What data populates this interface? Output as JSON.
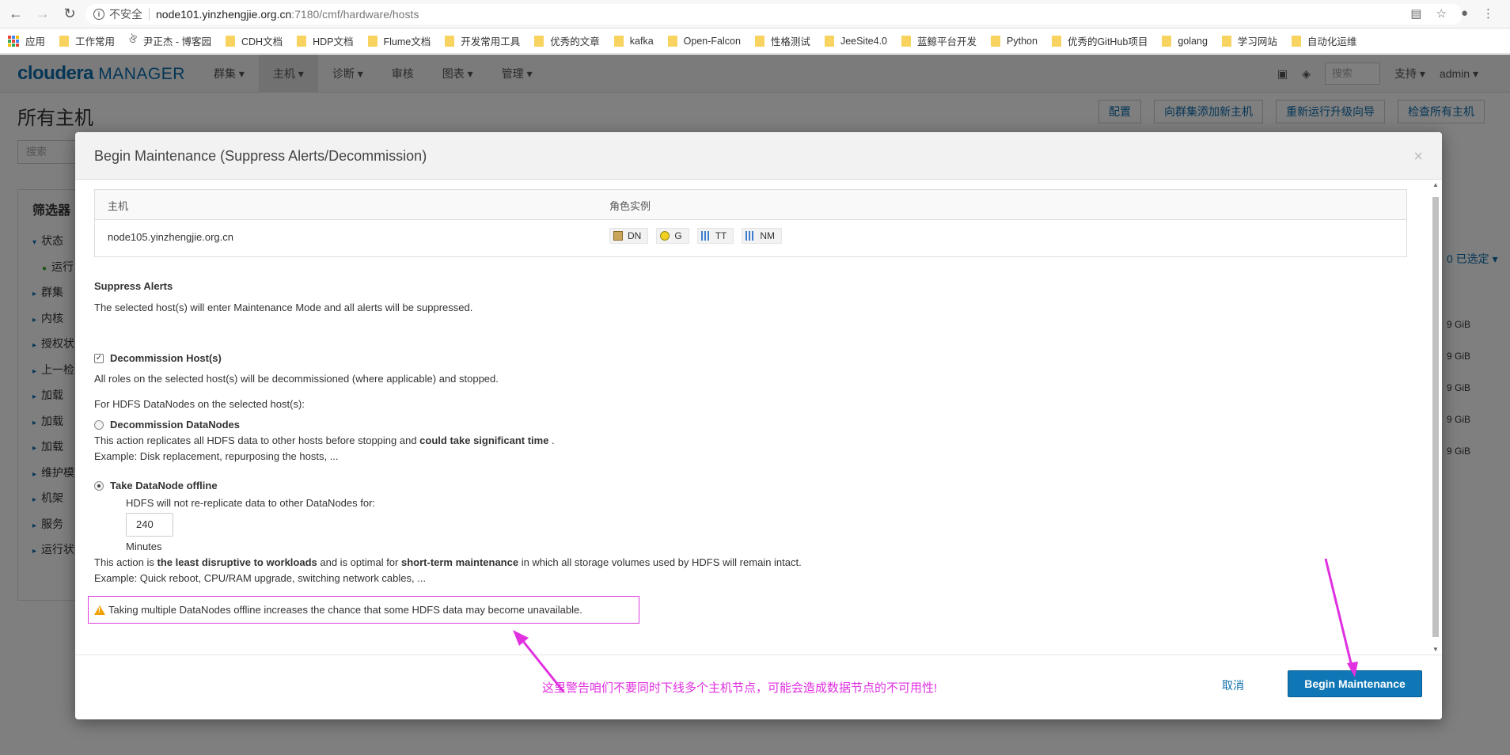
{
  "browser": {
    "insecure_label": "不安全",
    "url_host": "node101.yinzhengjie.org.cn",
    "url_path": ":7180/cmf/hardware/hosts",
    "bookmarks": [
      "应用",
      "工作常用",
      "尹正杰 - 博客园",
      "CDH文档",
      "HDP文档",
      "Flume文档",
      "开发常用工具",
      "优秀的文章",
      "kafka",
      "Open-Falcon",
      "性格测试",
      "JeeSite4.0",
      "蓝鲸平台开发",
      "Python",
      "优秀的GitHub项目",
      "golang",
      "学习网站",
      "自动化运维"
    ]
  },
  "cm": {
    "logo_main": "cloudera",
    "logo_sub": "MANAGER",
    "menu": [
      "群集",
      "主机",
      "诊断",
      "审核",
      "图表",
      "管理"
    ],
    "search_placeholder": "搜索",
    "support": "支持",
    "user": "admin",
    "page_title": "所有主机",
    "page_buttons": [
      "配置",
      "向群集添加新主机",
      "重新运行升级向导",
      "检查所有主机"
    ],
    "filter_search": "搜索",
    "filter_title": "筛选器",
    "filters": [
      "状态",
      "运行",
      "群集",
      "内核",
      "授权状",
      "上一检",
      "加载",
      "加载",
      "加载",
      "维护模",
      "机架",
      "服务",
      "运行状"
    ],
    "selected": "0 已选定",
    "gib_values": [
      "9 GiB",
      "9 GiB",
      "9 GiB",
      "9 GiB",
      "9 GiB"
    ]
  },
  "modal": {
    "title": "Begin Maintenance (Suppress Alerts/Decommission)",
    "close": "×",
    "table_head_host": "主机",
    "table_head_roles": "角色实例",
    "host": "node105.yinzhengjie.org.cn",
    "roles": [
      "DN",
      "G",
      "TT",
      "NM"
    ],
    "suppress_title": "Suppress Alerts",
    "suppress_desc": "The selected host(s) will enter Maintenance Mode and all alerts will be suppressed.",
    "decommission_label": "Decommission Host(s)",
    "decommission_checked": true,
    "decommission_desc": "All roles on the selected host(s) will be decommissioned (where applicable) and stopped.",
    "datanodes_intro": "For HDFS DataNodes on the selected host(s):",
    "opt1_label": "Decommission DataNodes",
    "opt1_desc_a": "This action replicates all HDFS data to other hosts before stopping and ",
    "opt1_desc_b": "could take significant time",
    "opt1_desc_c": " .",
    "opt1_example": "Example: Disk replacement, repurposing the hosts, ...",
    "opt2_label": "Take DataNode offline",
    "opt2_selected": true,
    "opt2_hint": "HDFS will not re-replicate data to other DataNodes for:",
    "minutes_value": "240",
    "minutes_label": "Minutes",
    "opt2_desc_a": "This action is ",
    "opt2_desc_b": "the least disruptive to workloads",
    "opt2_desc_c": " and is optimal for ",
    "opt2_desc_d": "short-term maintenance",
    "opt2_desc_e": " in which all storage volumes used by HDFS will remain intact.",
    "opt2_example": "Example: Quick reboot, CPU/RAM upgrade, switching network cables, ...",
    "warning": "Taking multiple DataNodes offline increases the chance that some HDFS data may become unavailable.",
    "cancel": "取消",
    "submit": "Begin Maintenance",
    "annotation": "这里警告咱们不要同时下线多个主机节点，可能会造成数据节点的不可用性!"
  },
  "colors": {
    "brand": "#0a6dac",
    "primary_button": "#0f77b6",
    "annotation": "#e030e0",
    "warning": "#f0a000"
  }
}
